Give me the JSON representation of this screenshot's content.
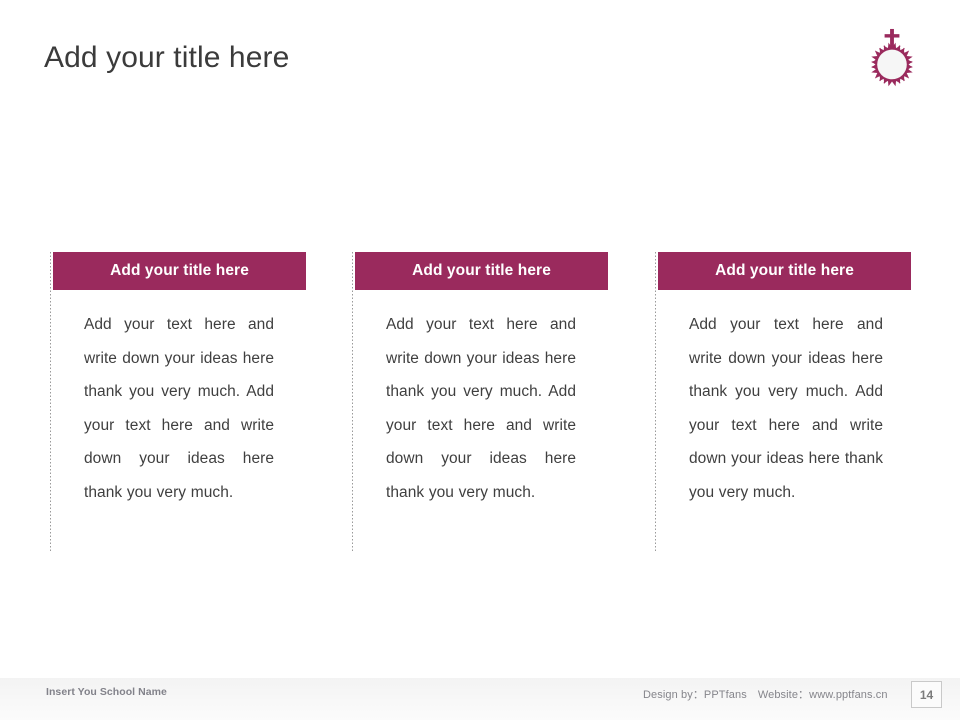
{
  "slide": {
    "title": "Add your title here",
    "page_number": "14",
    "accent_color": "#9a2a5d",
    "title_color": "#3b3b3b",
    "body_text_color": "#3f3f3f",
    "footer_text_color": "#82828a"
  },
  "logo": {
    "name": "crown-of-thorns-with-cross-logo",
    "color": "#9a2a5d"
  },
  "cards": [
    {
      "header": "Add your title here",
      "body": "Add your text here and write down your ideas here thank you very much. Add your text here and write down your ideas here thank you very much."
    },
    {
      "header": "Add your title here",
      "body": "Add your text here and write down your ideas here thank you very much. Add your text here and write down your ideas here thank you very much."
    },
    {
      "header": "Add your title here",
      "body": "Add your text here and write down your ideas here thank you very much. Add your text here and write down your ideas here thank you very much."
    }
  ],
  "footer": {
    "school_name": "Insert You School Name",
    "design_by": "Design by：PPTfans",
    "website": "Website：www.pptfans.cn"
  }
}
